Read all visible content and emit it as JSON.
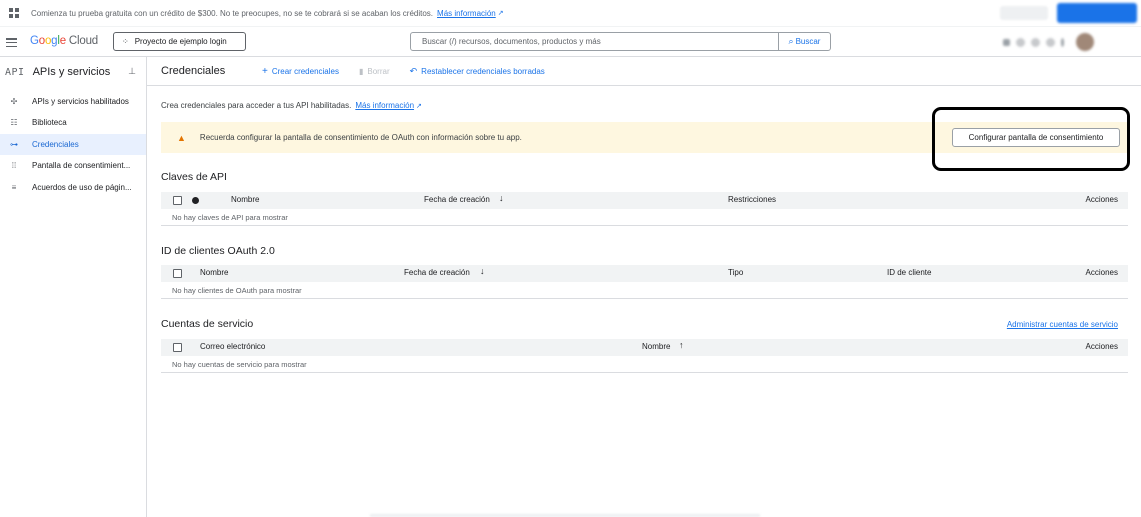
{
  "promo": {
    "text": "Comienza tu prueba gratuita con un crédito de $300. No te preocupes, no se te cobrará si se acaban los créditos.",
    "link": "Más información",
    "ext_icon": "↗"
  },
  "header": {
    "logo_letters": [
      "G",
      "o",
      "o",
      "g",
      "l",
      "e"
    ],
    "logo_cloud": "Cloud",
    "project": "Proyecto de ejemplo login",
    "search_placeholder": "Buscar (/) recursos, documentos, productos y más",
    "search_button": "Buscar"
  },
  "sidebar": {
    "api_badge": "API",
    "title": "APIs y servicios",
    "items": [
      {
        "icon": "✣",
        "label": "APIs y servicios habilitados"
      },
      {
        "icon": "☷",
        "label": "Biblioteca"
      },
      {
        "icon": "⊶",
        "label": "Credenciales"
      },
      {
        "icon": "⁞⁞",
        "label": "Pantalla de consentimient..."
      },
      {
        "icon": "≡",
        "label": "Acuerdos de uso de págin..."
      }
    ],
    "active_index": 2
  },
  "toolbar": {
    "page_title": "Credenciales",
    "create": "Crear credenciales",
    "delete": "Borrar",
    "restore": "Restablecer credenciales borradas"
  },
  "main": {
    "intro": "Crea credenciales para acceder a tus API habilitadas.",
    "intro_link": "Más información",
    "banner_text": "Recuerda configurar la pantalla de consentimiento de OAuth con información sobre tu app.",
    "banner_button": "Configurar pantalla de consentimiento",
    "api_keys": {
      "title": "Claves de API",
      "columns": [
        "Nombre",
        "Fecha de creación",
        "Restricciones",
        "Acciones"
      ],
      "empty": "No hay claves de API para mostrar"
    },
    "oauth": {
      "title": "ID de clientes OAuth 2.0",
      "columns": [
        "Nombre",
        "Fecha de creación",
        "Tipo",
        "ID de cliente",
        "Acciones"
      ],
      "empty": "No hay clientes de OAuth para mostrar"
    },
    "service_accounts": {
      "title": "Cuentas de servicio",
      "link": "Administrar cuentas de servicio",
      "columns": [
        "Correo electrónico",
        "Nombre",
        "Acciones"
      ],
      "empty": "No hay cuentas de servicio para mostrar"
    }
  },
  "colors": {
    "accent": "#1a73e8",
    "banner_bg": "#fef7e0",
    "warning": "#e37400",
    "active_bg": "#e8f0fe"
  }
}
